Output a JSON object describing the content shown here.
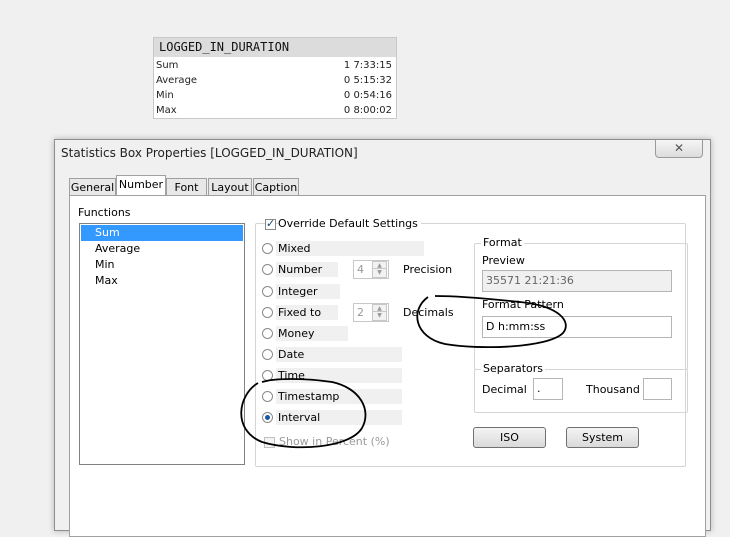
{
  "stat_box": {
    "title": "LOGGED_IN_DURATION",
    "rows": [
      {
        "label": "Sum",
        "value": "1 7:33:15"
      },
      {
        "label": "Average",
        "value": "0 5:15:32"
      },
      {
        "label": "Min",
        "value": "0 0:54:16"
      },
      {
        "label": "Max",
        "value": "0 8:00:02"
      }
    ]
  },
  "dialog": {
    "title": "Statistics Box Properties [LOGGED_IN_DURATION]",
    "close_icon": "close-icon",
    "tabs": [
      "General",
      "Number",
      "Font",
      "Layout",
      "Caption"
    ],
    "active_tab": "Number",
    "functions_label": "Functions",
    "functions": [
      "Sum",
      "Average",
      "Min",
      "Max"
    ],
    "selected_function": "Sum",
    "override_label": "Override Default Settings",
    "override_checked": true,
    "formats": [
      "Mixed",
      "Number",
      "Integer",
      "Fixed to",
      "Money",
      "Date",
      "Time",
      "Timestamp",
      "Interval"
    ],
    "selected_format": "Interval",
    "precision_label": "Precision",
    "precision_value": "4",
    "decimals_label": "Decimals",
    "decimals_value": "2",
    "show_percent_label": "Show in Percent (%)",
    "format_group": {
      "title": "Format",
      "preview_label": "Preview",
      "preview_value": "35571 21:21:36",
      "pattern_label": "Format Pattern",
      "pattern_value": "D h:mm:ss"
    },
    "separators": {
      "title": "Separators",
      "decimal_label": "Decimal",
      "decimal_value": ".",
      "thousand_label": "Thousand",
      "thousand_value": ""
    },
    "iso_button": "ISO",
    "system_button": "System"
  },
  "colors": {
    "selection": "#3399ff",
    "annotation": "#000000"
  }
}
